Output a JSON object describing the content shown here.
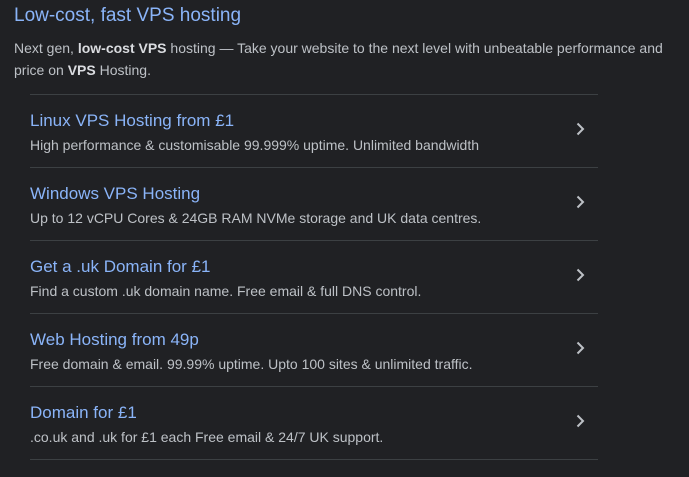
{
  "ad": {
    "title": "Low-cost, fast VPS hosting",
    "description": {
      "part1": "Next gen, ",
      "bold1": "low-cost VPS",
      "part2": " hosting — Take your website to the next level with unbeatable performance and price on ",
      "bold2": "VPS",
      "part3": " Hosting."
    }
  },
  "sitelinks": [
    {
      "title": "Linux VPS Hosting from £1",
      "description": "High performance & customisable 99.999% uptime. Unlimited bandwidth",
      "icon": "chevron-right-icon"
    },
    {
      "title": "Windows VPS Hosting",
      "description": "Up to 12 vCPU Cores & 24GB RAM NVMe storage and UK data centres.",
      "icon": "chevron-right-icon"
    },
    {
      "title": "Get a .uk Domain for £1",
      "description": "Find a custom .uk domain name. Free email & full DNS control.",
      "icon": "chevron-right-icon"
    },
    {
      "title": "Web Hosting from 49p",
      "description": "Free domain & email. 99.99% uptime. Upto 100 sites & unlimited traffic.",
      "icon": "chevron-right-icon"
    },
    {
      "title": "Domain for £1",
      "description": ".co.uk and .uk for £1 each Free email & 24/7 UK support.",
      "icon": "chevron-right-icon"
    }
  ],
  "colors": {
    "background": "#202124",
    "link": "#8ab4f8",
    "text": "#bdc1c6",
    "divider": "#3c4043"
  }
}
